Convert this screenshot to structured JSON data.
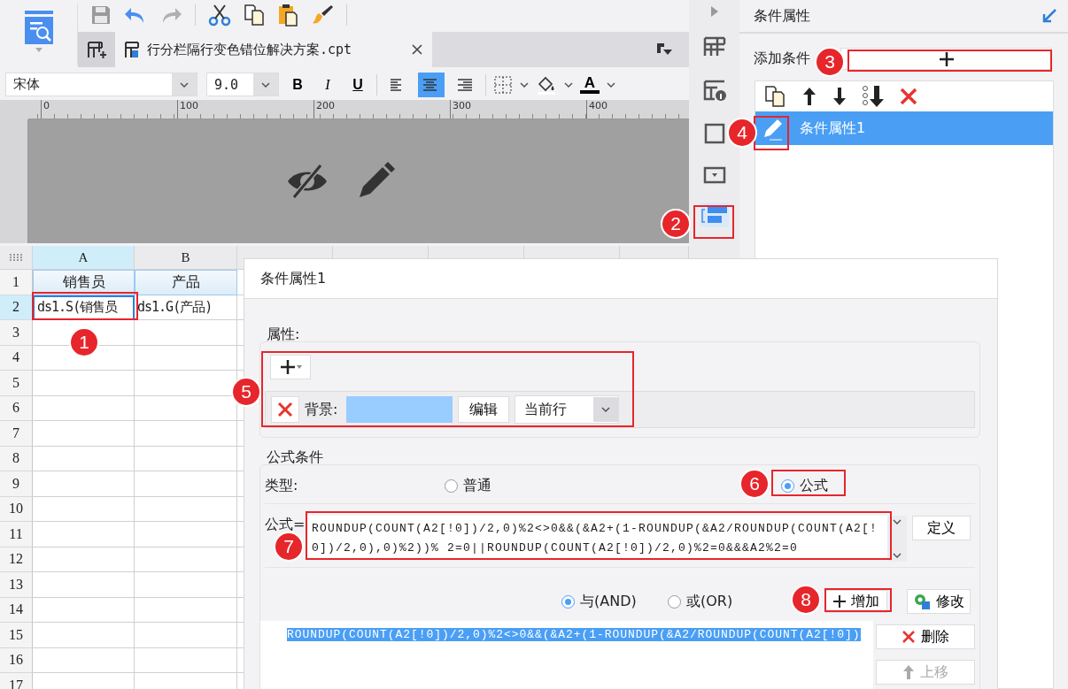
{
  "document_tab": {
    "title": "行分栏隔行变色错位解决方案.cpt",
    "selected": true
  },
  "format_bar": {
    "font": "宋体",
    "size": "9.0",
    "bold": "B",
    "italic": "I",
    "underline": "U",
    "font_color": "A",
    "alignments": [
      {
        "kind": "left",
        "selected": false
      },
      {
        "kind": "center",
        "selected": true
      },
      {
        "kind": "right",
        "selected": false
      }
    ]
  },
  "ruler": {
    "ticks": [
      "0",
      "100",
      "200",
      "300",
      "400"
    ]
  },
  "sheet": {
    "columns": [
      {
        "label": "A",
        "selected": true
      },
      {
        "label": "B",
        "selected": false
      }
    ],
    "rows": [
      {
        "number": "1",
        "selected": false,
        "kind": "title",
        "cells": [
          {
            "text": "销售员",
            "selected": false
          },
          {
            "text": "产品",
            "selected": false
          }
        ]
      },
      {
        "number": "2",
        "selected": true,
        "kind": "data",
        "cells": [
          {
            "text": "ds1.S(销售员",
            "selected": true
          },
          {
            "text": "ds1.G(产品)",
            "selected": false
          }
        ]
      },
      {
        "number": "3",
        "selected": false,
        "kind": "empty"
      },
      {
        "number": "4",
        "selected": false,
        "kind": "empty"
      },
      {
        "number": "5",
        "selected": false,
        "kind": "empty"
      },
      {
        "number": "6",
        "selected": false,
        "kind": "empty"
      },
      {
        "number": "7",
        "selected": false,
        "kind": "empty"
      },
      {
        "number": "8",
        "selected": false,
        "kind": "empty"
      },
      {
        "number": "9",
        "selected": false,
        "kind": "empty"
      },
      {
        "number": "10",
        "selected": false,
        "kind": "empty"
      },
      {
        "number": "11",
        "selected": false,
        "kind": "empty"
      },
      {
        "number": "12",
        "selected": false,
        "kind": "empty"
      },
      {
        "number": "13",
        "selected": false,
        "kind": "empty"
      },
      {
        "number": "14",
        "selected": false,
        "kind": "empty"
      },
      {
        "number": "15",
        "selected": false,
        "kind": "empty"
      },
      {
        "number": "16",
        "selected": false,
        "kind": "empty"
      },
      {
        "number": "17",
        "selected": false,
        "kind": "empty"
      }
    ]
  },
  "side_strip": [
    {
      "kind": "cell",
      "selected": false
    },
    {
      "kind": "widget",
      "selected": false
    },
    {
      "kind": "border",
      "selected": false
    },
    {
      "kind": "dropdown",
      "selected": false
    },
    {
      "kind": "condition",
      "selected": true
    }
  ],
  "right_panel": {
    "title": "条件属性",
    "add_label": "添加条件",
    "conditions": [
      {
        "name": "条件属性1",
        "selected": true
      }
    ]
  },
  "dialog": {
    "title": "条件属性1",
    "properties": {
      "legend": "属性:",
      "items": [
        {
          "label": "背景:",
          "color": "#99ccff",
          "edit_button": "编辑",
          "scope": "当前行"
        }
      ]
    },
    "formula_group": {
      "legend": "公式条件",
      "type_label": "类型:",
      "types": [
        {
          "label": "普通",
          "selected": false
        },
        {
          "label": "公式",
          "selected": true
        }
      ],
      "formula_label": "公式=",
      "formula": "ROUNDUP(COUNT(A2[!0])/2,0)%2<>0&&(&A2+(1-ROUNDUP(&A2/ROUNDUP(COUNT(A2[!0])/2,0),0)%2))% 2=0||ROUNDUP(COUNT(A2[!0])/2,0)%2=0&&&A2%2=0",
      "define_button": "定义",
      "joins": [
        {
          "label": "与(AND)",
          "selected": true
        },
        {
          "label": "或(OR)",
          "selected": false
        }
      ],
      "add_button": "增加",
      "modify_button": "修改",
      "conditions": [
        {
          "text": "ROUNDUP(COUNT(A2[!0])/2,0)%2<>0&&(&A2+(1-ROUNDUP(&A2/ROUNDUP(COUNT(A2[!0])",
          "selected": true
        }
      ],
      "delete_button": {
        "label": "删除",
        "disabled": false
      },
      "move_up_button": {
        "label": "上移",
        "disabled": true
      }
    }
  },
  "callouts": [
    {
      "number": "1"
    },
    {
      "number": "2"
    },
    {
      "number": "3"
    },
    {
      "number": "4"
    },
    {
      "number": "5"
    },
    {
      "number": "6"
    },
    {
      "number": "7"
    },
    {
      "number": "8"
    }
  ]
}
